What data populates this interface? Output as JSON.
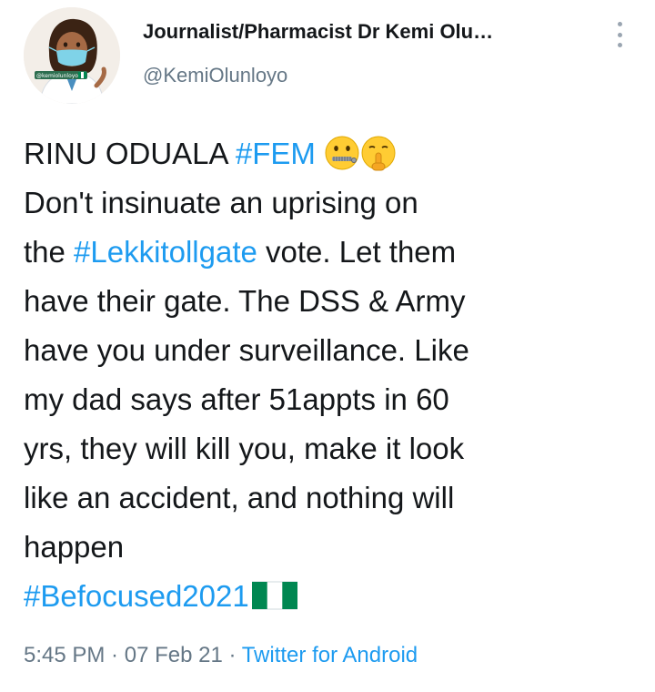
{
  "author": {
    "display_name": "Journalist/Pharmacist Dr Kemi Olu…",
    "handle": "@KemiOlunloyo",
    "avatar_badge_text": "@kemiolunloyo"
  },
  "icons": {
    "more": "more-vertical-icon",
    "zipper_mouth": "zipper-mouth-face-emoji",
    "shushing": "shushing-face-emoji",
    "flag": "nigeria-flag-emoji"
  },
  "colors": {
    "link": "#1d9bf0",
    "text": "#14171a",
    "secondary": "#657786",
    "flag_green": "#008751"
  },
  "tweet": {
    "line1_text": "RINU ODUALA ",
    "line1_hashtag": "#FEM",
    "line2": "Don't insinuate an uprising on",
    "line3_pre": "the ",
    "line3_hashtag": "#Lekkitollgate",
    "line3_post": " vote. Let them",
    "line4": "have their gate. The DSS & Army",
    "line5": "have you under surveillance. Like",
    "line6": "my dad says after 51appts in 60",
    "line7": "yrs, they will kill you, make it look",
    "line8": "like an accident, and nothing will",
    "line9": "happen",
    "line10_hashtag": "#Befocused2021"
  },
  "meta": {
    "time": "5:45 PM",
    "separator1": " · ",
    "date": "07 Feb 21",
    "separator2": " · ",
    "source": "Twitter for Android"
  }
}
